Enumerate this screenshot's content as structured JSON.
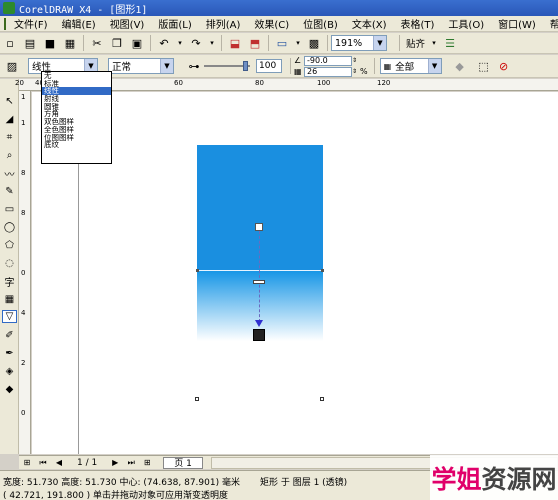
{
  "window": {
    "title": "CorelDRAW X4 - [图形1]"
  },
  "menu": [
    "文件(F)",
    "编辑(E)",
    "视图(V)",
    "版面(L)",
    "排列(A)",
    "效果(C)",
    "位图(B)",
    "文本(X)",
    "表格(T)",
    "工具(O)",
    "窗口(W)",
    "帮助(H)"
  ],
  "toolbar": {
    "zoom": "191%",
    "snap": "贴齐"
  },
  "propertybar": {
    "fill_type": "线性",
    "blend_mode": "正常",
    "midpoint": "100",
    "angle": "-90.0",
    "edge_pad": "26",
    "percent_sign": "%",
    "target": "全部"
  },
  "fill_type_options": [
    "无",
    "标准",
    "线性",
    "射线",
    "圆锥",
    "方角",
    "双色图样",
    "全色图样",
    "位图图样",
    "底纹"
  ],
  "fill_type_selected_index": 2,
  "ruler": {
    "h_labels": [
      "20",
      "40",
      "60",
      "80",
      "100",
      "120"
    ],
    "v_labels": [
      "1",
      "1",
      "8",
      "8",
      "0",
      "4",
      "2",
      "0"
    ]
  },
  "pagenav": {
    "counter": "1 / 1",
    "tab": "页 1"
  },
  "status": {
    "line1": "宽度: 51.730  高度: 51.730  中心: (74.638, 87.901)  毫米",
    "object": "矩形 于 图层 1 (透镜)",
    "line2": "( 42.721, 191.800 )    单击并拖动对象可应用渐变透明度"
  },
  "watermark": {
    "part1": "学姐",
    "part2": "资源网"
  },
  "colors": {
    "titlebar": "#2a57b8",
    "fill": "#1a8fe0",
    "selection": "#316ac5",
    "watermark": "#e0006a"
  }
}
